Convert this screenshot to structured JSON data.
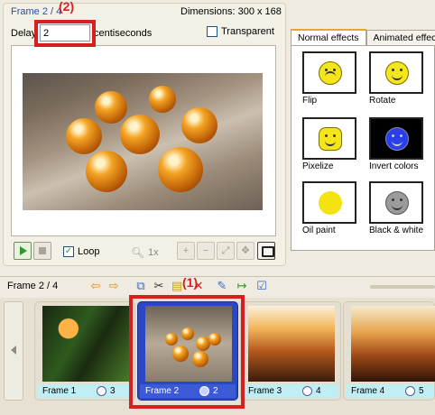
{
  "frame_props": {
    "frame_label": "Frame 2 / 4",
    "dimensions": "Dimensions: 300 x 168",
    "delay_label": "Delay",
    "delay_value": "2",
    "delay_unit": "centiseconds",
    "transparent_label": "Transparent",
    "transparent_checked": false
  },
  "playback": {
    "loop_label": "Loop",
    "loop_checked": true,
    "zoom_value": "1x"
  },
  "effects": {
    "tabs": [
      "Normal effects",
      "Animated effects"
    ],
    "active_tab": 0,
    "items": [
      {
        "label": "Flip",
        "icon": "smiley-flip-icon"
      },
      {
        "label": "Rotate",
        "icon": "smiley-rotate-icon"
      },
      {
        "label": "Pixelize",
        "icon": "smiley-pixelize-icon"
      },
      {
        "label": "Invert colors",
        "icon": "smiley-invert-icon"
      },
      {
        "label": "Oil paint",
        "icon": "smiley-oil-icon"
      },
      {
        "label": "Black & white",
        "icon": "smiley-bw-icon"
      }
    ]
  },
  "toolbar": {
    "frame_label": "Frame 2 / 4"
  },
  "frames": [
    {
      "name": "Frame 1",
      "delay": "3",
      "selected": false
    },
    {
      "name": "Frame 2",
      "delay": "2",
      "selected": true
    },
    {
      "name": "Frame 3",
      "delay": "4",
      "selected": false
    },
    {
      "name": "Frame 4",
      "delay": "5",
      "selected": false
    }
  ],
  "annotations": {
    "label_1": "(1)",
    "label_2": "(2)"
  },
  "colors": {
    "annotation_red": "#d42020",
    "selected_frame_blue": "#2a48c4",
    "frame_bar_cyan": "#bfeef5",
    "tab_accent": "#e8a72a"
  }
}
